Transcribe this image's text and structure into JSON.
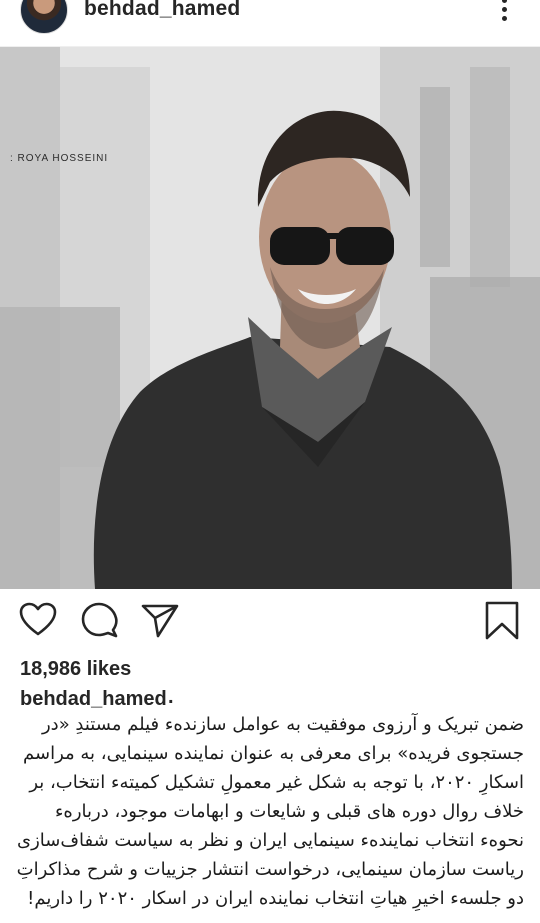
{
  "header": {
    "username": "behdad_hamed",
    "avatar_icon": "profile-avatar",
    "more_icon": "vertical-dots-icon"
  },
  "photo": {
    "credit": ": ROYA HOSSEINI"
  },
  "actions": {
    "like_icon": "heart-icon",
    "comment_icon": "comment-icon",
    "share_icon": "paper-plane-icon",
    "save_icon": "bookmark-icon"
  },
  "post": {
    "likes": "18,986 likes",
    "caption_user": "behdad_hamed",
    "caption_sep": ".",
    "caption_text": "ضمن تبریک و آرزوی موفقیت به عوامل سازندهء فیلم مستندِ «در جستجوی فریده» برای معرفی به عنوان نماینده سینمایی، به مراسم اسکارِ ۲۰۲۰، با توجه به شکل غیر معمولِ تشکیل کمیتهء انتخاب، بر خلاف روال دوره های قبلی و شایعات و ابهامات موجود، دربارهء نحوهء انتخاب نمایندهء سینمایی ایران و نظر به سیاست شفاف‌سازی ریاست سازمان سینمایی، درخواست انتشار جزییات و شرح مذاکراتِ دو جلسهء اخیرِ هیاتِ انتخاب نماینده ایران در اسکار ۲۰۲۰ را داریم!"
  }
}
